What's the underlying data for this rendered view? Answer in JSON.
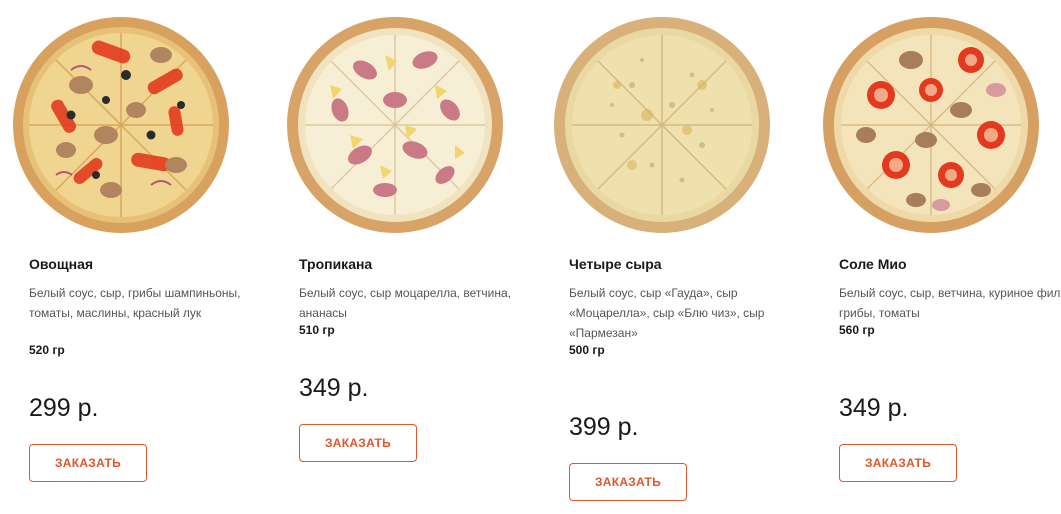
{
  "products": [
    {
      "name": "Овощная",
      "description": "Белый соус, сыр, грибы шампиньоны, томаты, маслины, красный лук",
      "weight": "520 гр",
      "price": "299 р.",
      "button_label": "ЗАКАЗАТЬ"
    },
    {
      "name": "Тропикана",
      "description": "Белый соус, сыр моцарелла, ветчина, ананасы",
      "weight": "510 гр",
      "price": "349 р.",
      "button_label": "ЗАКАЗАТЬ"
    },
    {
      "name": "Четыре сыра",
      "description": "Белый соус, сыр «Гауда», сыр «Моцарелла», сыр «Блю чиз», сыр «Пармезан»",
      "weight": "500 гр",
      "price": "399 р.",
      "button_label": "ЗАКАЗАТЬ"
    },
    {
      "name": "Соле Мио",
      "description": "Белый соус, сыр, ветчина, куриное филе, грибы, томаты",
      "weight": "560 гр",
      "price": "349 р.",
      "button_label": "ЗАКАЗАТЬ"
    }
  ],
  "colors": {
    "accent": "#e0572a",
    "text": "#1a1a1a",
    "muted": "#555555"
  }
}
